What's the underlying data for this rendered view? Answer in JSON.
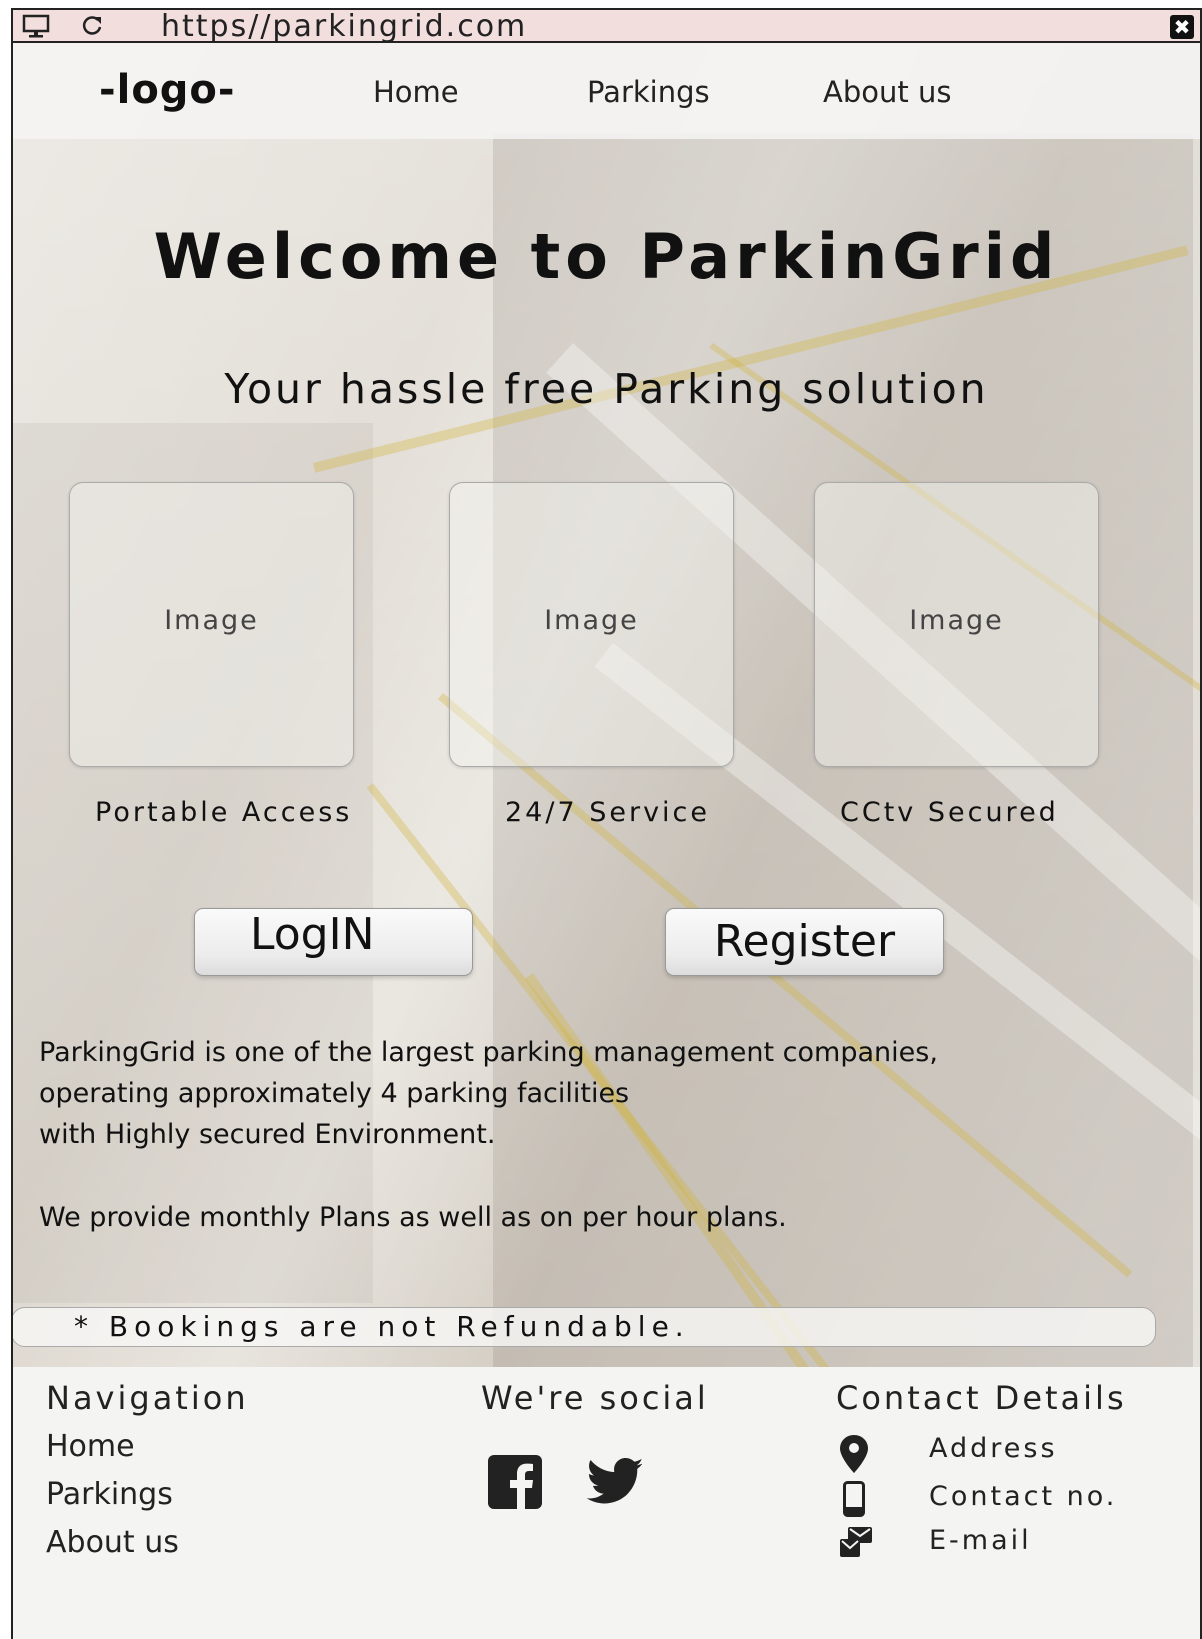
{
  "browser": {
    "url": "https//parkingrid.com",
    "icons": [
      "monitor-icon",
      "refresh-icon",
      "close-icon"
    ],
    "close_glyph": "✖"
  },
  "nav": {
    "logo": "-logo-",
    "links": [
      "Home",
      "Parkings",
      "About us"
    ]
  },
  "hero": {
    "title": "Welcome to ParkinGrid",
    "subtitle": "Your hassle free Parking solution"
  },
  "features": [
    {
      "image_label": "Image",
      "caption": "Portable Access"
    },
    {
      "image_label": "Image",
      "caption": "24/7 Service"
    },
    {
      "image_label": "Image",
      "caption": "CCtv Secured"
    }
  ],
  "buttons": {
    "login": "LogIN",
    "register": "Register"
  },
  "about": {
    "line1": "ParkingGrid is one of the largest parking management companies,",
    "line2": "operating approximately 4 parking facilities",
    "line3": "with Highly secured Environment.",
    "line4": "We provide monthly Plans as well as on per hour plans."
  },
  "notice": "*  Bookings are not Refundable.",
  "footer": {
    "navigation": {
      "heading": "Navigation",
      "links": [
        "Home",
        "Parkings",
        "About us"
      ]
    },
    "social": {
      "heading": "We're social",
      "icons": [
        "facebook-icon",
        "twitter-icon"
      ]
    },
    "contact": {
      "heading": "Contact Details",
      "items": [
        {
          "icon": "map-pin-icon",
          "label": "Address"
        },
        {
          "icon": "phone-icon",
          "label": "Contact no."
        },
        {
          "icon": "mail-icon",
          "label": "E-mail"
        }
      ]
    }
  }
}
